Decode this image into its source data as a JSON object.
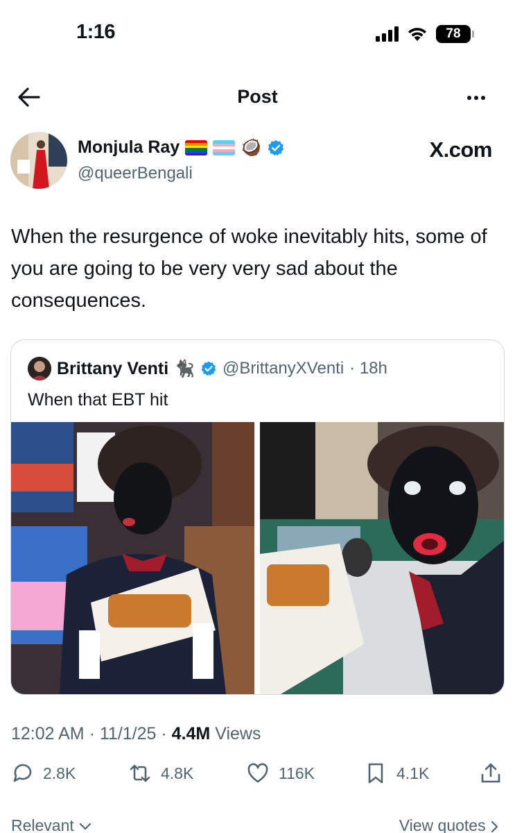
{
  "status_bar": {
    "time": "1:16",
    "battery": "78"
  },
  "nav": {
    "title": "Post"
  },
  "author": {
    "name": "Monjula Ray",
    "handle": "@queerBengali",
    "coconut_emoji": "🥥"
  },
  "brand": "X.com",
  "post": {
    "text": "When the resurgence of woke inevitably hits, some of you are going to be very very sad about the consequences."
  },
  "quote": {
    "name": "Brittany Venti",
    "cat_emoji": "🐈‍⬛",
    "handle": "@BrittanyXVenti",
    "time": "· 18h",
    "text": "When that EBT hit"
  },
  "meta": {
    "time": "12:02 AM",
    "date": "11/1/25",
    "views_count": "4.4M",
    "views_label": "Views",
    "sep": "·"
  },
  "actions": {
    "replies": "2.8K",
    "reposts": "4.8K",
    "likes": "116K",
    "bookmarks": "4.1K"
  },
  "bottom": {
    "relevant": "Relevant",
    "view_quotes": "View quotes"
  },
  "colors": {
    "text": "#0f1419",
    "secondary": "#536471",
    "verified": "#1d9bf0",
    "border": "#cfd9de"
  }
}
